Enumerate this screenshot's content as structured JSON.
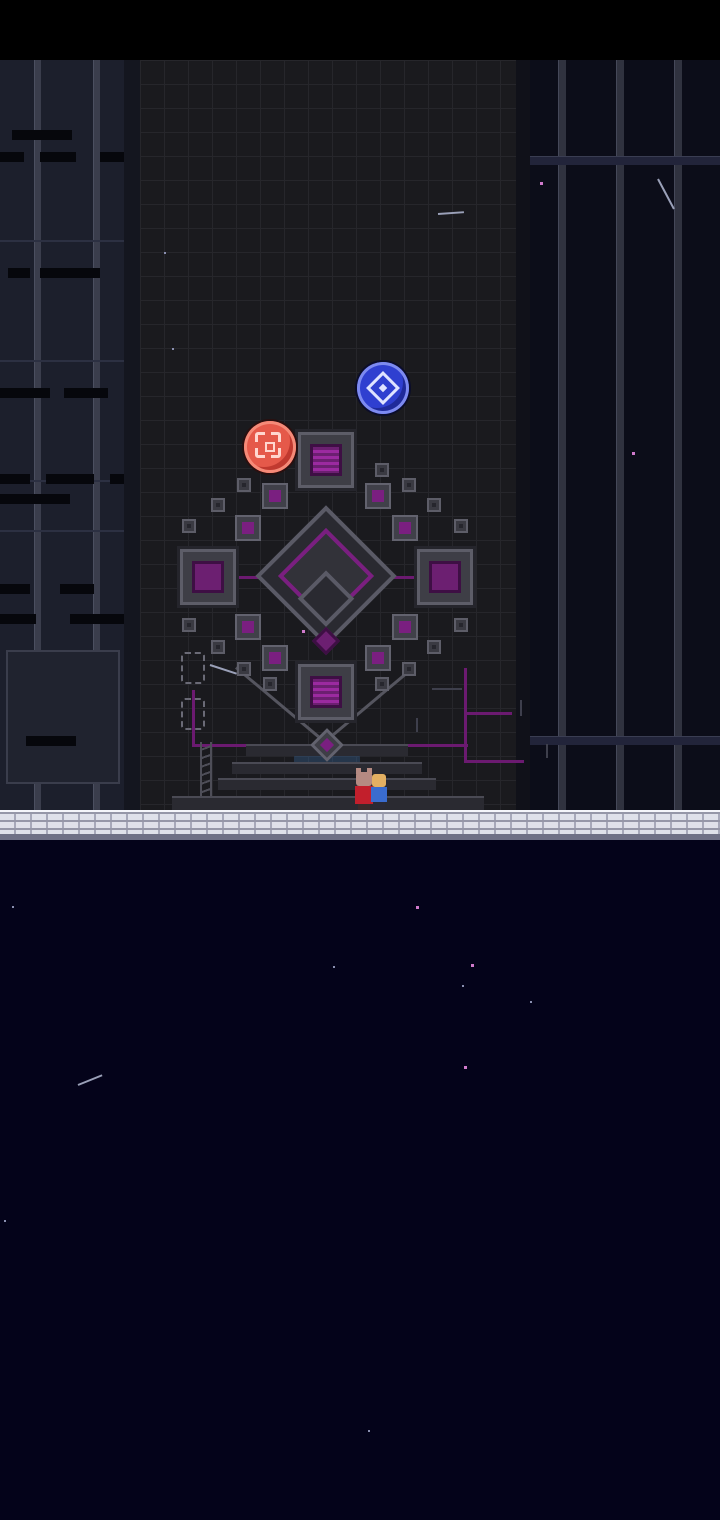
{
  "scene": {
    "name": "tower-throne-room",
    "colors": {
      "sky": "#04031a",
      "tower": "#1a1a1e",
      "accent": "#7a1f80",
      "ground": "#dfe1ea"
    }
  },
  "orbs": [
    {
      "name": "red-target-orb",
      "color": "#e5594a",
      "icon": "crosshair-icon"
    },
    {
      "name": "blue-diamond-orb",
      "color": "#2f3fd0",
      "icon": "diamond-icon"
    }
  ],
  "characters": [
    {
      "name": "player-red-cloak",
      "color": "#c21f2c"
    },
    {
      "name": "companion-blue",
      "color": "#3a6ccf"
    }
  ]
}
